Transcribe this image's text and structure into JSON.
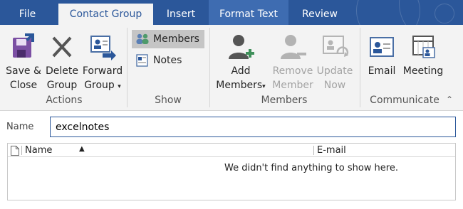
{
  "tabs": [
    {
      "id": "file",
      "label": "File"
    },
    {
      "id": "contact_group",
      "label": "Contact Group"
    },
    {
      "id": "insert",
      "label": "Insert"
    },
    {
      "id": "format_text",
      "label": "Format Text"
    },
    {
      "id": "review",
      "label": "Review"
    }
  ],
  "active_tab": "Contact Group",
  "ribbon": {
    "actions": {
      "save_close": [
        "Save &",
        "Close"
      ],
      "delete_group": [
        "Delete",
        "Group"
      ],
      "forward_group": [
        "Forward",
        "Group"
      ],
      "label": "Actions"
    },
    "show": {
      "members": "Members",
      "notes": "Notes",
      "label": "Show"
    },
    "members": {
      "add_members": [
        "Add",
        "Members"
      ],
      "remove_member": [
        "Remove",
        "Member"
      ],
      "update_now": [
        "Update",
        "Now"
      ],
      "label": "Members"
    },
    "communicate": {
      "email": "Email",
      "meeting": "Meeting",
      "label": "Communicate"
    }
  },
  "form": {
    "name_label": "Name",
    "name_value": "excelnotes"
  },
  "list": {
    "col_name": "Name",
    "col_email": "E-mail",
    "empty_message": "We didn't find anything to show here."
  },
  "colors": {
    "tab_bar": "#2b579a",
    "context_tab": "#3e6cb1",
    "ribbon_bg": "#f3f3f3",
    "accent": "#2b579a",
    "disabled_text": "#a3a3a3"
  }
}
